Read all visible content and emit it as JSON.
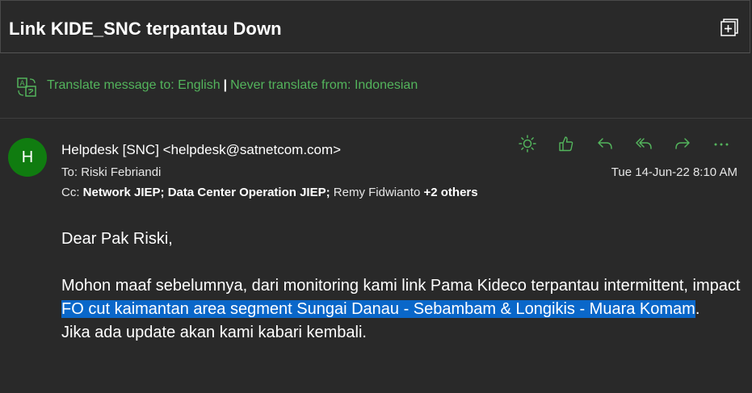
{
  "header": {
    "subject": "Link KIDE_SNC terpantau Down"
  },
  "translate": {
    "translate_label": "Translate message to: English",
    "separator": "|",
    "never_label": "Never translate from: Indonesian"
  },
  "message": {
    "avatar_initial": "H",
    "sender": "Helpdesk [SNC] <helpdesk@satnetcom.com>",
    "to_label": "To:",
    "to_value": "Riski Febriandi",
    "cc_label": "Cc:",
    "cc_1": "Network JIEP;",
    "cc_2": "Data Center Operation JIEP;",
    "cc_3": "Remy Fidwianto",
    "cc_more": "+2 others",
    "date": "Tue 14-Jun-22 8:10 AM"
  },
  "actions": [
    "sun-icon",
    "like-icon",
    "reply-icon",
    "reply-all-icon",
    "forward-icon",
    "more-icon"
  ],
  "body": {
    "greeting": "Dear Pak Riski,",
    "para1_a": "Mohon maaf sebelumnya, dari monitoring kami link Pama Kideco terpantau intermittent, impact ",
    "para1_hl": "FO cut kaimantan area segment Sungai Danau - Sebambam & Longikis - Muara Komam",
    "para1_end": ".",
    "para2": "Jika ada update akan kami kabari kembali."
  },
  "colors": {
    "accent_green": "#53b45c",
    "avatar_bg": "#107c10",
    "highlight": "#0a67c9",
    "background": "#292929"
  }
}
